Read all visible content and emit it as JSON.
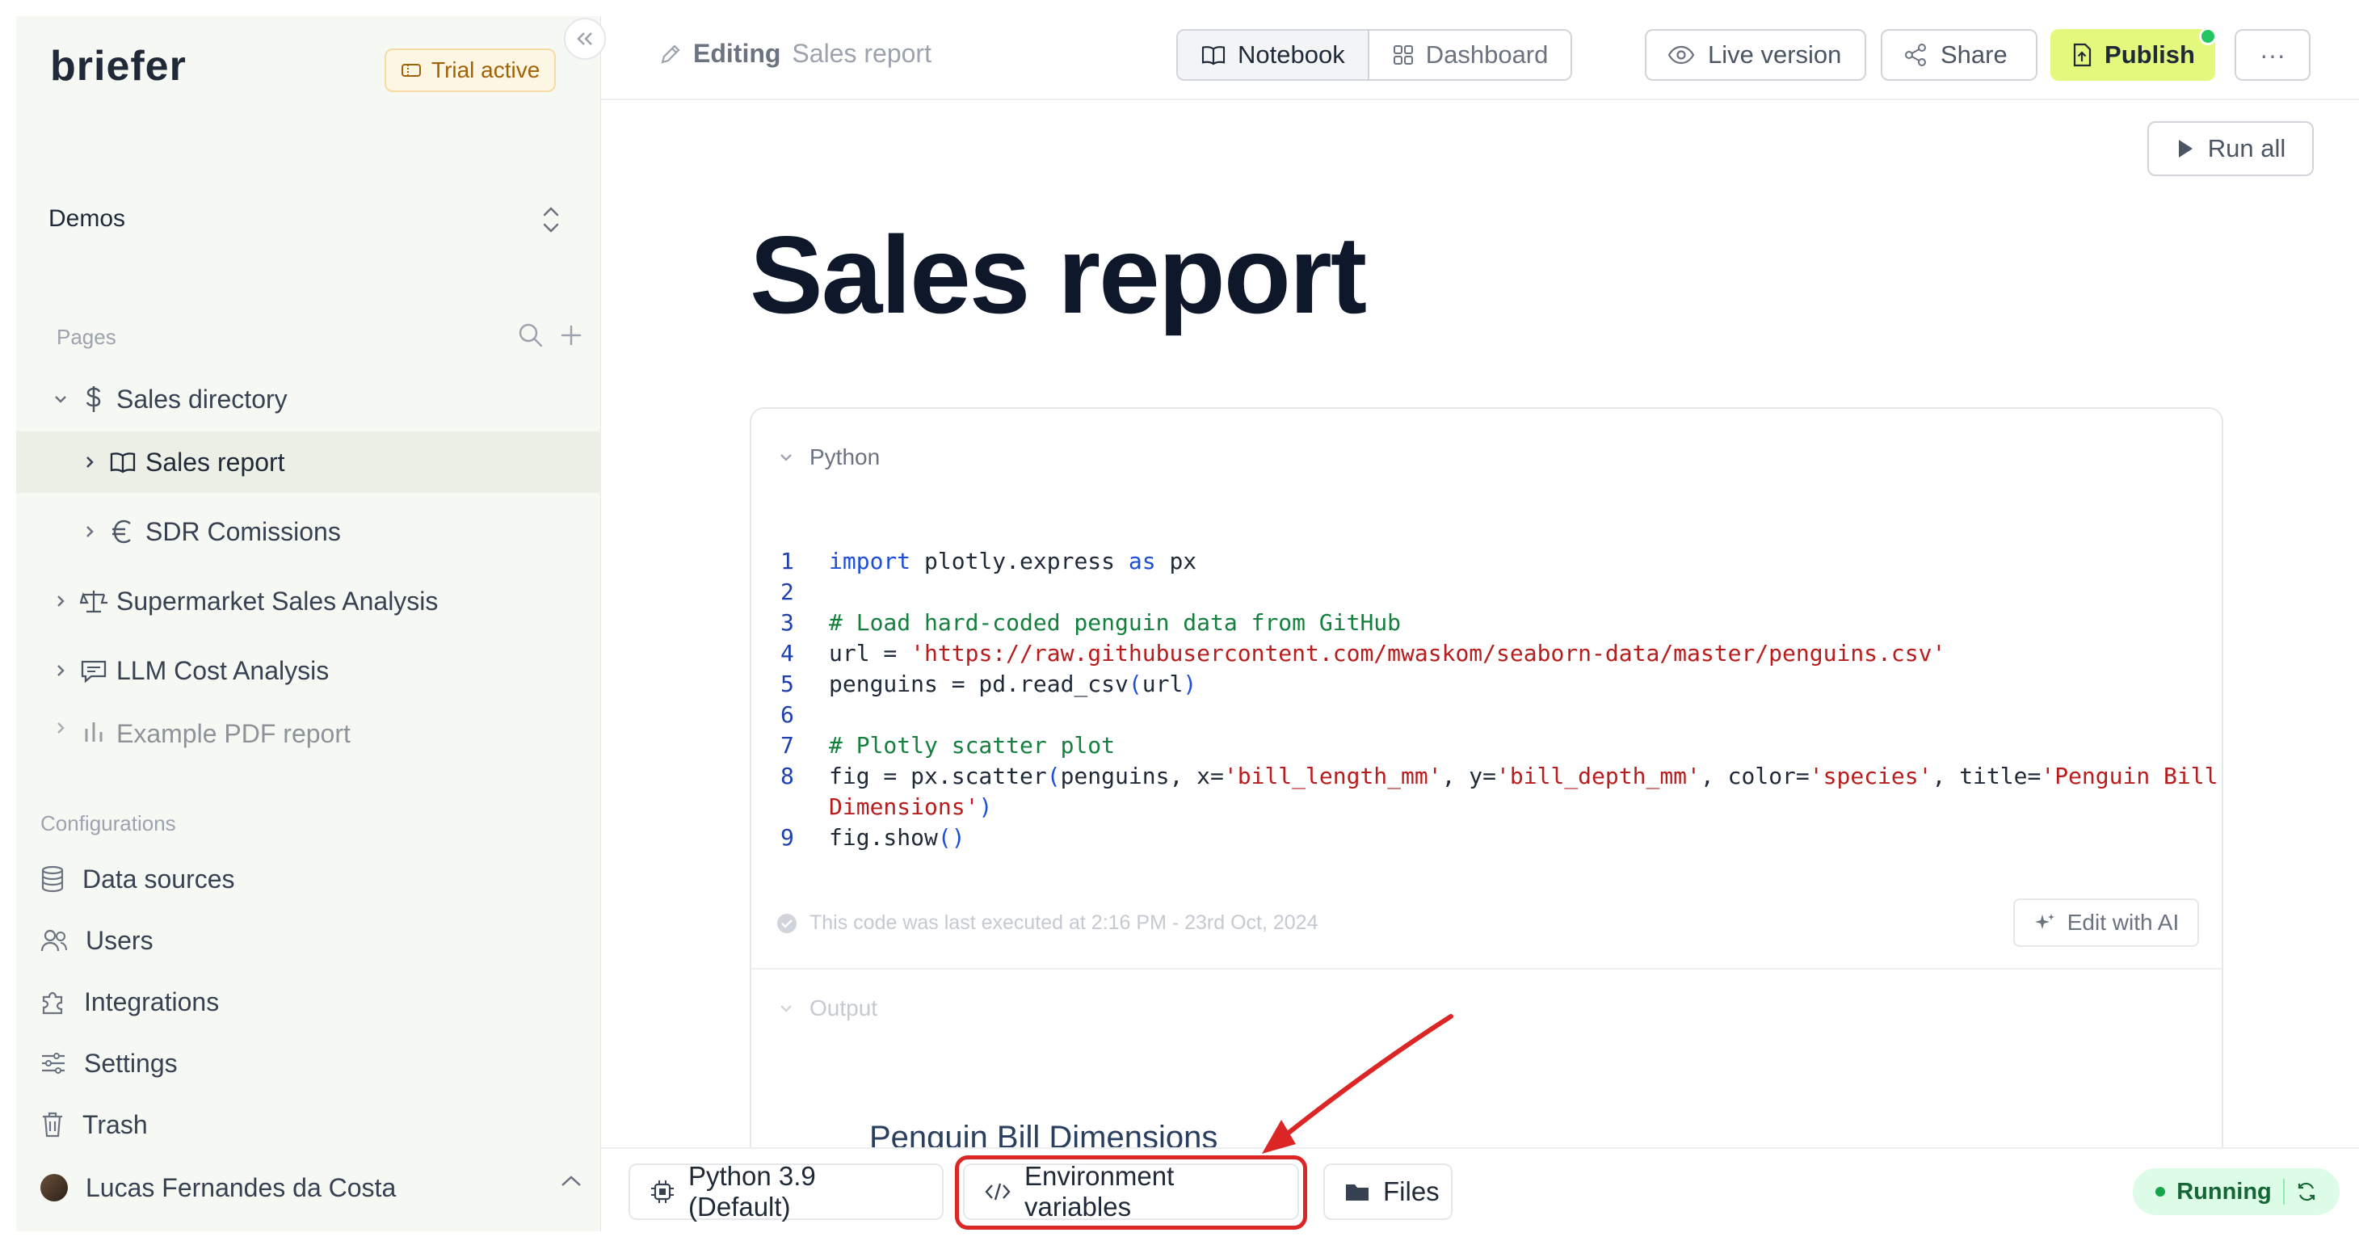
{
  "sidebar": {
    "logo": "briefer",
    "trial_badge": "Trial active",
    "workspace": "Demos",
    "pages_label": "Pages",
    "pages": [
      {
        "label": "Sales directory",
        "icon": "dollar-icon"
      },
      {
        "label": "Sales report",
        "icon": "book-icon"
      },
      {
        "label": "SDR Comissions",
        "icon": "euro-icon"
      },
      {
        "label": "Supermarket Sales Analysis",
        "icon": "scale-icon"
      },
      {
        "label": "LLM Cost Analysis",
        "icon": "chat-icon"
      },
      {
        "label": "Example PDF report",
        "icon": "bar-chart-icon"
      }
    ],
    "configurations_label": "Configurations",
    "config_items": [
      {
        "label": "Data sources",
        "icon": "database-icon"
      },
      {
        "label": "Users",
        "icon": "users-icon"
      },
      {
        "label": "Integrations",
        "icon": "puzzle-icon"
      },
      {
        "label": "Settings",
        "icon": "sliders-icon"
      },
      {
        "label": "Trash",
        "icon": "trash-icon"
      }
    ],
    "user_name": "Lucas Fernandes da Costa"
  },
  "topbar": {
    "editing_prefix": "Editing",
    "editing_doc": "Sales report",
    "view_notebook": "Notebook",
    "view_dashboard": "Dashboard",
    "live_version": "Live version",
    "share": "Share",
    "publish": "Publish",
    "more": "···"
  },
  "notebook": {
    "run_all": "Run all",
    "title": "Sales report",
    "cell_type": "Python",
    "code_lines": [
      {
        "n": "1",
        "parts": [
          {
            "t": "import",
            "c": "kw"
          },
          {
            "t": " plotly.express ",
            "c": ""
          },
          {
            "t": "as",
            "c": "kw"
          },
          {
            "t": " px",
            "c": ""
          }
        ]
      },
      {
        "n": "2",
        "parts": [
          {
            "t": "",
            "c": ""
          }
        ]
      },
      {
        "n": "3",
        "parts": [
          {
            "t": "# Load hard-coded penguin data from GitHub",
            "c": "cm"
          }
        ]
      },
      {
        "n": "4",
        "parts": [
          {
            "t": "url = ",
            "c": ""
          },
          {
            "t": "'https://raw.githubusercontent.com/mwaskom/seaborn-data/master/penguins.csv'",
            "c": "st"
          }
        ]
      },
      {
        "n": "5",
        "parts": [
          {
            "t": "penguins = pd.read_csv",
            "c": ""
          },
          {
            "t": "(",
            "c": "kw"
          },
          {
            "t": "url",
            "c": ""
          },
          {
            "t": ")",
            "c": "kw"
          }
        ]
      },
      {
        "n": "6",
        "parts": [
          {
            "t": "",
            "c": ""
          }
        ]
      },
      {
        "n": "7",
        "parts": [
          {
            "t": "# Plotly scatter plot",
            "c": "cm"
          }
        ]
      },
      {
        "n": "8",
        "parts": [
          {
            "t": "fig = px.scatter",
            "c": ""
          },
          {
            "t": "(",
            "c": "kw"
          },
          {
            "t": "penguins, x=",
            "c": ""
          },
          {
            "t": "'bill_length_mm'",
            "c": "st"
          },
          {
            "t": ", y=",
            "c": ""
          },
          {
            "t": "'bill_depth_mm'",
            "c": "st"
          },
          {
            "t": ", color=",
            "c": ""
          },
          {
            "t": "'species'",
            "c": "st"
          },
          {
            "t": ", title=",
            "c": ""
          },
          {
            "t": "'Penguin Bill",
            "c": "st"
          }
        ]
      },
      {
        "n": "",
        "parts": [
          {
            "t": "Dimensions'",
            "c": "st"
          },
          {
            "t": ")",
            "c": "kw"
          }
        ]
      },
      {
        "n": "9",
        "parts": [
          {
            "t": "fig.show",
            "c": ""
          },
          {
            "t": "()",
            "c": "kw"
          }
        ]
      }
    ],
    "exec_status": "This code was last executed at 2:16 PM - 23rd Oct, 2024",
    "edit_with_ai": "Edit with AI",
    "output_label": "Output",
    "plot_title": "Penguin Bill Dimensions"
  },
  "bottombar": {
    "python_env": "Python 3.9 (Default)",
    "env_vars": "Environment variables",
    "files": "Files",
    "status": "Running"
  },
  "colors": {
    "accent_publish": "#e5f87e",
    "annotation": "#dc2626",
    "running_bg": "#dcfce7"
  }
}
